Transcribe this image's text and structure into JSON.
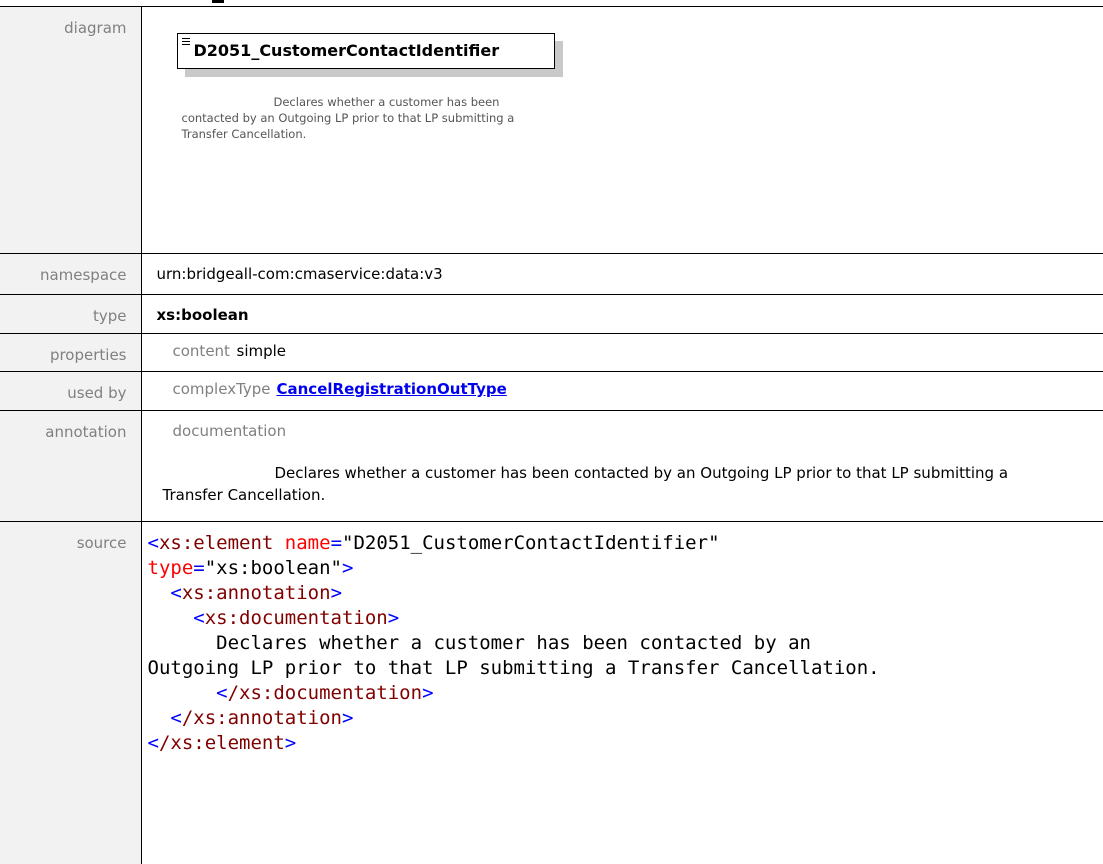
{
  "labels": {
    "diagram": "diagram",
    "namespace": "namespace",
    "type": "type",
    "properties": "properties",
    "used_by": "used by",
    "annotation": "annotation",
    "source": "source"
  },
  "diagram": {
    "element_name": "D2051_CustomerContactIdentifier",
    "description": "Declares whether a customer has been contacted by an Outgoing LP prior to that LP submitting a Transfer Cancellation."
  },
  "namespace": "urn:bridgeall-com:cmaservice:data:v3",
  "type": "xs:boolean",
  "properties": {
    "key": "content",
    "value": "simple"
  },
  "used_by": {
    "key": "complexType",
    "link": "CancelRegistrationOutType"
  },
  "annotation": {
    "key": "documentation",
    "text": "Declares whether a customer has been contacted by an Outgoing LP prior to that LP submitting a Transfer Cancellation."
  },
  "source": {
    "open_tag": "xs:element",
    "name_attr": "name",
    "name_val": "\"D2051_CustomerContactIdentifier\"",
    "type_attr": "type",
    "type_val": "\"xs:boolean\"",
    "annotation_tag": "xs:annotation",
    "documentation_tag": "xs:documentation",
    "doc_line1": "Declares whether a customer has been contacted by an",
    "doc_line2": "Outgoing LP prior to that LP submitting a Transfer Cancellation.",
    "close_documentation": "/xs:documentation",
    "close_annotation": "/xs:annotation",
    "close_element": "/xs:element"
  }
}
